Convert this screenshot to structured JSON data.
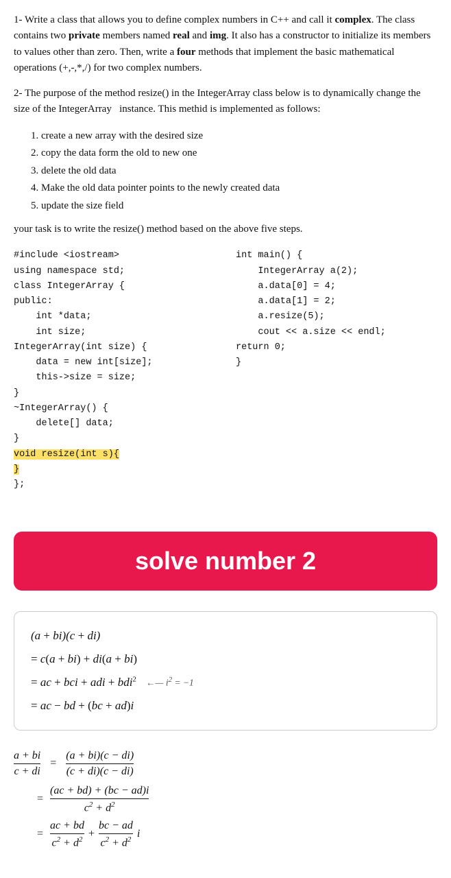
{
  "problem1": {
    "text": "1- Write a class that allows you to define complex numbers in C++ and call it ",
    "bold_class": "complex",
    "text2": ". The class contains two ",
    "bold_private": "private",
    "text3": " members named ",
    "bold_real": "real",
    "text4": " and ",
    "bold_img": "img",
    "text5": ". It also has a constructor to initialize its members to values other than zero. Then, write a ",
    "bold_four": "four",
    "text6": " methods that implement the basic mathematical operations (+,-,*,/) for two complex numbers."
  },
  "problem2": {
    "text": "2- The purpose of the method resize() in the IntegerArray class below is to dynamically change the size of the IntegerArray  instance. This methid is implemented as follows:"
  },
  "steps": {
    "items": [
      "create a new array with the desired size",
      "copy the data form the old to new one",
      "delete the old data",
      "Make the old data pointer points to the newly created data",
      "update the size field"
    ]
  },
  "task_line": "your task is to write the resize() method based on the above five steps.",
  "code_left": [
    "#include <iostream>",
    "using namespace std;",
    "class IntegerArray {",
    "public:",
    "    int *data;",
    "    int size;",
    "IntegerArray(int size) {",
    "    data = new int[size];",
    "    this->size = size;",
    "}",
    "~IntegerArray() {",
    "    delete[] data;",
    "}",
    "HIGHLIGHT:void resize(int s){",
    "HIGHLIGHT:}",
    "};"
  ],
  "code_right": [
    "int main() {",
    "    IntegerArray a(2);",
    "    a.data[0] = 4;",
    "    a.data[1] = 2;",
    "    a.resize(5);",
    "    cout << a.size << endl;",
    "return 0;",
    "}"
  ],
  "banner": {
    "text": "solve number 2"
  },
  "math_box": {
    "lines": [
      "(a+bi)(c+di)",
      "= c(a+bi) + di(a+bi)",
      "= ac + bci + adi + bdi² ← i² = −1",
      "= ac − bd + (bc + ad)i"
    ]
  },
  "division": {
    "lhs_numer": "a + bi",
    "lhs_denom": "c + di",
    "eq1_numer": "(a + bi)(c - di)",
    "eq1_denom": "(c + di)(c - di)",
    "eq2_numer": "(ac + bd) + (bc - ad)i",
    "eq2_denom": "c² + d²",
    "eq3_n1": "ac + bd",
    "eq3_d1": "c² + d²",
    "eq3_n2": "bc - ad",
    "eq3_d2": "c² + d²",
    "eq3_i": "i"
  }
}
